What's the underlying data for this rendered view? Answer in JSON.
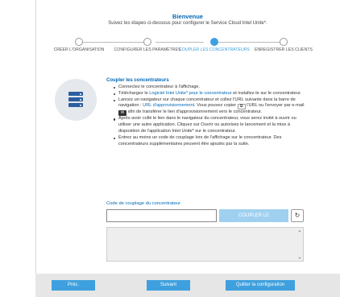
{
  "header": {
    "title": "Bienvenue",
    "subtitle": "Suivez les étapes ci-dessous pour configurer le Service Cloud Intel Unite*."
  },
  "stepper": {
    "steps": [
      {
        "label": "CRÉER L'ORGANISATION",
        "state": "done"
      },
      {
        "label": "CONFIGURER LES PARAMÈTRES",
        "state": "done"
      },
      {
        "label": "COUPLER LES CONCENTRATEURS",
        "state": "active"
      },
      {
        "label": "ENREGISTRER LES CLIENTS",
        "state": "pending"
      }
    ]
  },
  "hero": {
    "icon": "server-stack-icon"
  },
  "content": {
    "title": "Coupler les concentrateurs",
    "items": {
      "i1": "Connectez le concentrateur à l'affichage.",
      "i2_pre": "Téléchargez le ",
      "i2_link": "Logiciel Intel Unite* pour le concentrateur",
      "i2_post": " et installez-le sur le concentrateur.",
      "i3_pre": "Lancez un navigateur sur chaque concentrateur et collez l'URL suivante dans la barre de navigation : ",
      "i3_link": "URL d'approvisionnement",
      "i3_mid1": ". Vous pouvez copier ",
      "i3_mid2": " l'URL ou l'envoyer par e-mail ",
      "i3_post": " afin de transférer le lien d'approvisionnement vers le concentrateur.",
      "i4": "Après avoir collé le lien dans le navigateur du concentrateur, vous serez invité à ouvrir ou utiliser une autre application. Cliquez sur Ouvrir ou autorisez le lancement et la mise à disposition de l'application Intel Unite* sur le concentrateur.",
      "i5": "Entrez au moins un code de couplage lors de l'affichage sur le concentrateur. Des concentrateurs supplémentaires peuvent être ajoutés par la suite."
    }
  },
  "pairing": {
    "label": "Code de couplage du concentrateur",
    "input_value": "",
    "couple_button": "COUPLER LE CONCENTRATEUR",
    "refresh_icon": "refresh-icon"
  },
  "footer": {
    "prev": "Préc.",
    "next": "Suivant",
    "quit": "Quitter la configuration"
  },
  "colors": {
    "accent": "#3ea0de",
    "link": "#0068b5",
    "footer_bg": "#e6e6e6",
    "button_disabled": "#9fd0f0"
  }
}
